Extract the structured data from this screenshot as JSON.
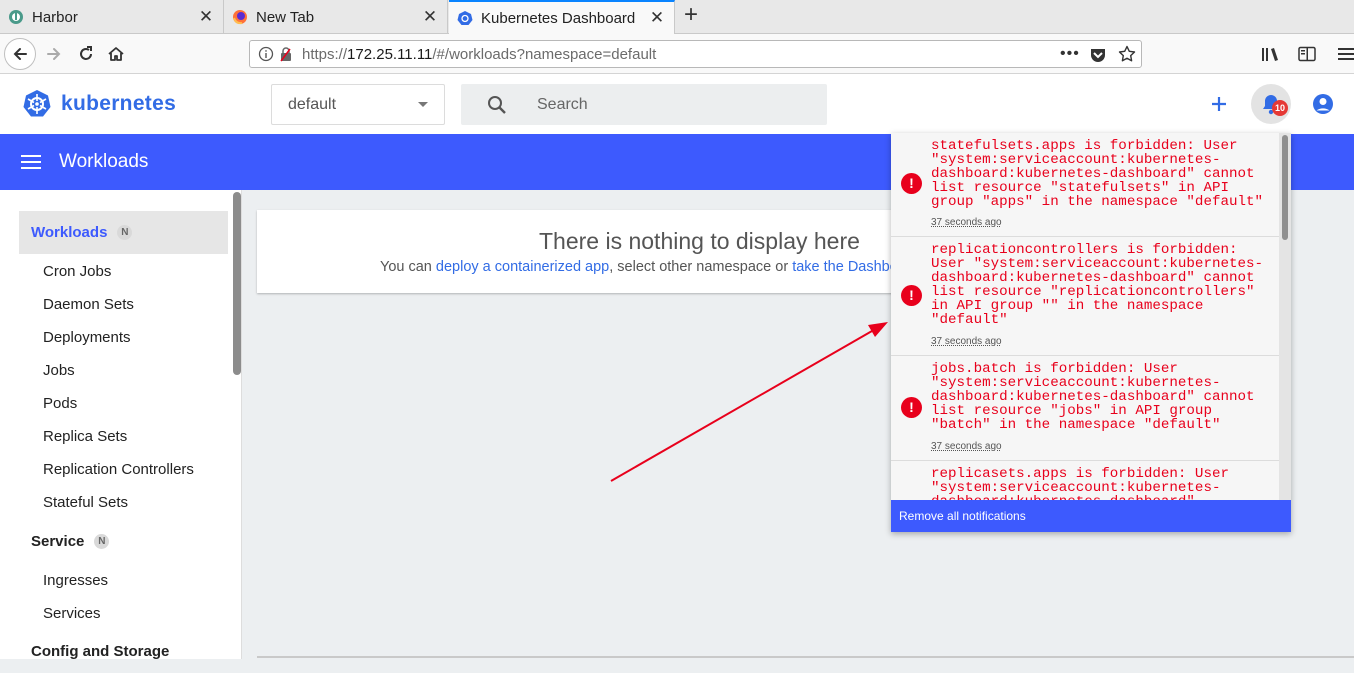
{
  "browser": {
    "tabs": [
      {
        "title": "Harbor",
        "icon": "harbor-icon"
      },
      {
        "title": "New Tab",
        "icon": "firefox-icon"
      },
      {
        "title": "Kubernetes Dashboard",
        "icon": "kubernetes-icon"
      }
    ],
    "url_prefix": "https://",
    "url_host": "172.25.11.11",
    "url_path": "/#/workloads?namespace=default"
  },
  "header": {
    "brand": "kubernetes",
    "namespace": "default",
    "search_placeholder": "Search",
    "notification_count": "10"
  },
  "toolbar": {
    "title": "Workloads"
  },
  "sidebar": {
    "sections": [
      {
        "label": "Workloads",
        "badge": "N"
      },
      {
        "label": "Service",
        "badge": "N"
      },
      {
        "label": "Config and Storage"
      }
    ],
    "workload_items": [
      "Cron Jobs",
      "Daemon Sets",
      "Deployments",
      "Jobs",
      "Pods",
      "Replica Sets",
      "Replication Controllers",
      "Stateful Sets"
    ],
    "service_items": [
      "Ingresses",
      "Services"
    ]
  },
  "main": {
    "empty_title": "There is nothing to display here",
    "empty_prefix": "You can ",
    "deploy_link": "deploy a containerized app",
    "empty_middle": ", select other namespace or ",
    "tour_link": "take the Dashboard"
  },
  "notifications": {
    "items": [
      {
        "message": "statefulsets.apps is forbidden: User \"system:serviceaccount:kubernetes-dashboard:kubernetes-dashboard\" cannot list resource \"statefulsets\" in API group \"apps\" in the namespace \"default\"",
        "time": "37 seconds ago"
      },
      {
        "message": "replicationcontrollers is forbidden: User \"system:serviceaccount:kubernetes-dashboard:kubernetes-dashboard\" cannot list resource \"replicationcontrollers\" in API group \"\" in the namespace \"default\"",
        "time": "37 seconds ago"
      },
      {
        "message": "jobs.batch is forbidden: User \"system:serviceaccount:kubernetes-dashboard:kubernetes-dashboard\" cannot list resource \"jobs\" in API group \"batch\" in the namespace \"default\"",
        "time": "37 seconds ago"
      },
      {
        "message": "replicasets.apps is forbidden: User \"system:serviceaccount:kubernetes-dashboard:kubernetes-dashboard\"",
        "time": ""
      }
    ],
    "remove_all_label": "Remove all notifications"
  },
  "colors": {
    "accent": "#3d5afe",
    "brand": "#326ce5",
    "error": "#e8001c"
  }
}
